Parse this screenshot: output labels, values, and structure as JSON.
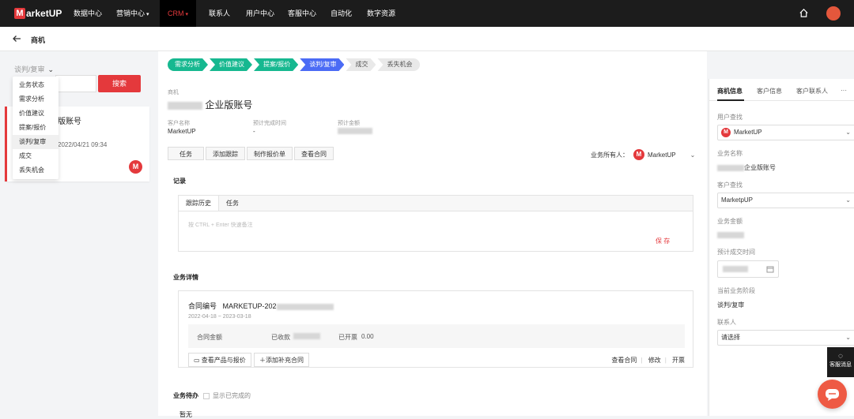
{
  "topnav": {
    "logo_text": "arketUP",
    "logo_letter": "M",
    "items": [
      "数据中心",
      "营销中心",
      "CRM",
      "联系人",
      "用户中心",
      "客服中心",
      "自动化",
      "数字资源"
    ]
  },
  "subheader": {
    "title": "商机"
  },
  "left": {
    "stage_select": "谈判/复审",
    "search_button": "搜索",
    "dropdown_options": [
      "业务状态",
      "需求分析",
      "价值建议",
      "提案/报价",
      "谈判/复审",
      "成交",
      "丢失机会"
    ],
    "card": {
      "title": "版账号",
      "date": "2022/04/21 09:34",
      "avatar": "M"
    }
  },
  "stages": [
    "需求分析",
    "价值建议",
    "提案/报价",
    "谈判/复审",
    "成交",
    "丢失机会"
  ],
  "opportunity": {
    "label": "商机",
    "title_suffix": "企业版账号",
    "customer_name_label": "客户名称",
    "customer_name": "MarketUP",
    "expected_date_label": "预计完成时间",
    "expected_date": "-",
    "expected_amount_label": "预计金额"
  },
  "action_buttons": [
    "任务",
    "添加跟踪",
    "制作报价单",
    "查看合同"
  ],
  "owner": {
    "label": "业务所有人：",
    "name": "MarketUP",
    "avatar": "M"
  },
  "record": {
    "section_title": "记录",
    "tabs": [
      "跟踪历史",
      "任务"
    ],
    "placeholder": "按 CTRL + Enter 快速备注",
    "save": "保 存"
  },
  "details": {
    "section_title": "业务详情",
    "contract_label": "合同编号",
    "contract_prefix": "MARKETUP-202",
    "date_range": "2022-04-18 ~ 2023-03-18",
    "contract_amount_label": "合同金额",
    "received_label": "已收款",
    "invoiced_label": "已开票",
    "invoiced_value": "0.00",
    "btn_products": "查看产品与报价",
    "btn_add_contract": "添加补充合同",
    "link_view": "查看合同",
    "link_edit": "修改",
    "link_invoice": "开票"
  },
  "todo": {
    "section_title": "业务待办",
    "checkbox_label": "显示已完成的",
    "sub": "暂无"
  },
  "right": {
    "tabs": [
      "商机信息",
      "客户信息",
      "客户联系人"
    ],
    "more": "···",
    "user_lookup_label": "用户查找",
    "user_lookup_value": "MarketUP",
    "biz_name_label": "业务名称",
    "biz_name_value": "企业版账号",
    "customer_lookup_label": "客户查找",
    "customer_lookup_value": "MarketpUP",
    "amount_label": "业务金额",
    "expected_date_label": "预计成交时间",
    "stage_label": "当前业务阶段",
    "stage_value": "谈判/复审",
    "contact_label": "联系人",
    "contact_value": "请选择"
  },
  "service": {
    "label": "客服消息"
  }
}
